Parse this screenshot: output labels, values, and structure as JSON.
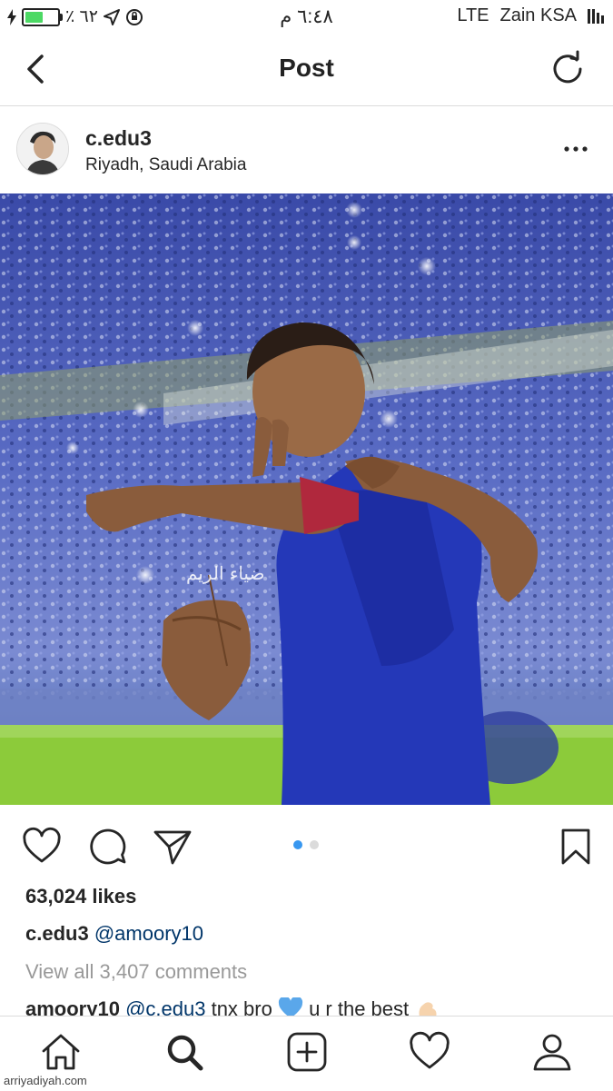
{
  "status_bar": {
    "battery_percent": "٪ ٦٢",
    "time": "٦:٤٨ م",
    "network": "LTE",
    "carrier": "Zain KSA",
    "battery_level": 0.62,
    "icons": [
      "charging-icon",
      "battery-icon",
      "location-arrow-icon",
      "orientation-lock-icon",
      "signal-icon"
    ]
  },
  "nav": {
    "title": "Post",
    "back_icon": "chevron-left-icon",
    "refresh_icon": "refresh-icon"
  },
  "post": {
    "username": "c.edu3",
    "location": "Riyadh, Saudi Arabia",
    "watermark": "ضياء الريم",
    "carousel": {
      "count": 2,
      "active": 1
    },
    "likes": "63,024 likes",
    "caption": {
      "user": "c.edu3",
      "text": "@amoory10"
    },
    "view_comments": "View all 3,407 comments",
    "comment": {
      "user": "amoory10",
      "mention": "@c.edu3",
      "text": " tnx bro ",
      "text2": " u r the best "
    }
  },
  "actions": {
    "icons": [
      "heart-icon",
      "comment-icon",
      "share-icon",
      "bookmark-icon"
    ]
  },
  "tabs": [
    "home-icon",
    "search-icon",
    "add-icon",
    "activity-heart-icon",
    "profile-icon"
  ],
  "source_watermark": "arriyadiyah.com",
  "colors": {
    "accent": "#3897f0",
    "mention": "#003569",
    "muted": "#999999",
    "divider": "#dbdbdb"
  }
}
